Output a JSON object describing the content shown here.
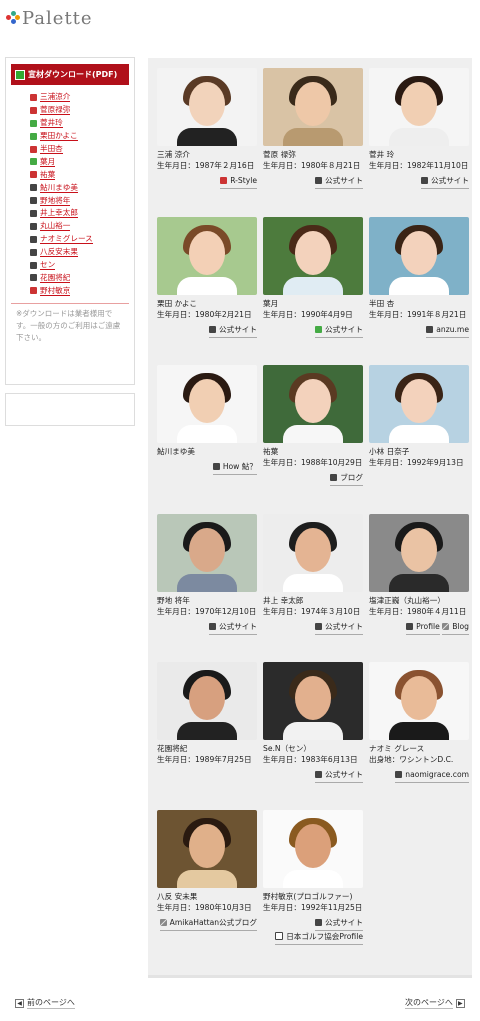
{
  "site": {
    "logo": "Palette"
  },
  "sidebar": {
    "heading": "宣材ダウンロード(PDF)",
    "items": [
      {
        "label": "三浦涼介",
        "color": "#c33"
      },
      {
        "label": "菅原禄弥",
        "color": "#c33"
      },
      {
        "label": "菅井玲",
        "color": "#4a4"
      },
      {
        "label": "栗田かよこ",
        "color": "#4a4"
      },
      {
        "label": "半田杏",
        "color": "#c33"
      },
      {
        "label": "葉月",
        "color": "#4a4"
      },
      {
        "label": "祐葉",
        "color": "#c33"
      },
      {
        "label": "鮎川まゆ美",
        "color": "#444"
      },
      {
        "label": "野地将年",
        "color": "#444"
      },
      {
        "label": "井上幸太郎",
        "color": "#444"
      },
      {
        "label": "丸山裕一",
        "color": "#444"
      },
      {
        "label": "ナオミグレース",
        "color": "#444"
      },
      {
        "label": "八反安末果",
        "color": "#444"
      },
      {
        "label": "セン",
        "color": "#444"
      },
      {
        "label": "花園将紀",
        "color": "#444"
      },
      {
        "label": "野村敏京",
        "color": "#c33"
      }
    ],
    "note": "※ダウンロードは業者様用です。一般の方のご利用はご遠慮下さい。"
  },
  "talents": [
    {
      "name": "三浦 涼介",
      "birth": "生年月日：1987年２月16日",
      "links": [
        {
          "label": "R-Style",
          "icon": "red"
        }
      ],
      "photo": {
        "bg": "#f3f3f3",
        "hair": "#5a3a25",
        "skin": "#f2d3bb",
        "clothes": "#222"
      }
    },
    {
      "name": "菅原 禄弥",
      "birth": "生年月日：1980年８月21日",
      "links": [
        {
          "label": "公式サイト",
          "icon": "dark"
        }
      ],
      "photo": {
        "bg": "#d9c3a5",
        "hair": "#3a2a1a",
        "skin": "#eec8a8",
        "clothes": "#b89a70"
      }
    },
    {
      "name": "菅井 玲",
      "birth": "生年月日：1982年11月10日",
      "links": [
        {
          "label": "公式サイト",
          "icon": "dark"
        }
      ],
      "photo": {
        "bg": "#f5f5f5",
        "hair": "#2a1a12",
        "skin": "#f1cfb3",
        "clothes": "#eee"
      }
    },
    {
      "name": "栗田 かよこ",
      "birth": "生年月日：1980年2月21日",
      "links": [
        {
          "label": "公式サイト",
          "icon": "dark"
        }
      ],
      "photo": {
        "bg": "#a7c98f",
        "hair": "#7a4a28",
        "skin": "#f3d0b6",
        "clothes": "#fff"
      }
    },
    {
      "name": "葉月",
      "birth": "生年月日：1990年4月9日",
      "links": [
        {
          "label": "公式サイト",
          "icon": "grn"
        }
      ],
      "photo": {
        "bg": "#4d7b3d",
        "hair": "#4a2a18",
        "skin": "#f3d2bc",
        "clothes": "#e0ecf3"
      }
    },
    {
      "name": "半田 杏",
      "birth": "生年月日：1991年８月21日",
      "links": [
        {
          "label": "anzu.me",
          "icon": "dark"
        }
      ],
      "photo": {
        "bg": "#7fb1c8",
        "hair": "#3a2416",
        "skin": "#f3d2bc",
        "clothes": "#fff"
      }
    },
    {
      "name": "鮎川まゆ美",
      "birth": "",
      "links": [
        {
          "label": "How 鮎？",
          "icon": "dark"
        }
      ],
      "photo": {
        "bg": "#f6f6f6",
        "hair": "#2a1a12",
        "skin": "#f1cfb3",
        "clothes": "#fff"
      }
    },
    {
      "name": "祐葉",
      "birth": "生年月日：1988年10月29日",
      "links": [
        {
          "label": "ブログ",
          "icon": "dark"
        }
      ],
      "photo": {
        "bg": "#3f6a3a",
        "hair": "#5a3a22",
        "skin": "#f3d2bc",
        "clothes": "#f7f7f7"
      }
    },
    {
      "name": "小林 日奈子",
      "birth": "生年月日：1992年9月13日",
      "links": [],
      "photo": {
        "bg": "#b7d2e2",
        "hair": "#3a2416",
        "skin": "#f3d2bc",
        "clothes": "#fff"
      }
    },
    {
      "name": "野地 将年",
      "birth": "生年月日：1970年12月10日",
      "links": [
        {
          "label": "公式サイト",
          "icon": "dark"
        }
      ],
      "photo": {
        "bg": "#b9c7b8",
        "hair": "#1a1a1a",
        "skin": "#d9a98a",
        "clothes": "#7c8aa0"
      }
    },
    {
      "name": "井上 幸太郎",
      "birth": "生年月日：1974年３月10日",
      "links": [
        {
          "label": "公式サイト",
          "icon": "dark"
        }
      ],
      "photo": {
        "bg": "#ededed",
        "hair": "#1e1e1e",
        "skin": "#e4b493",
        "clothes": "#fff"
      }
    },
    {
      "name": "塩津正巍（丸山裕一）",
      "birth": "生年月日：1980年４月11日",
      "links": [
        {
          "label": "Profile",
          "icon": "dark"
        },
        {
          "label": "Blog",
          "icon": "pen"
        }
      ],
      "photo": {
        "bg": "#8a8a8a",
        "hair": "#1a1a1a",
        "skin": "#eac3a4",
        "clothes": "#2a2a2a"
      }
    },
    {
      "name": "花園将紀",
      "birth": "生年月日：1989年7月25日",
      "links": [],
      "photo": {
        "bg": "#eaeaea",
        "hair": "#1a1a1a",
        "skin": "#d7a07f",
        "clothes": "#222"
      }
    },
    {
      "name": "Se.N（セン）",
      "birth": "生年月日：1983年6月13日",
      "links": [
        {
          "label": "公式サイト",
          "icon": "dark"
        }
      ],
      "photo": {
        "bg": "#2b2b2b",
        "hair": "#3a2a1a",
        "skin": "#e2b08e",
        "clothes": "#f2f2f2"
      }
    },
    {
      "name": "ナオミ グレース",
      "birth": "出身地：ワシントンD.C.",
      "links": [
        {
          "label": "naomigrace.com",
          "icon": "dark"
        }
      ],
      "photo": {
        "bg": "#f7f7f7",
        "hair": "#8a5230",
        "skin": "#e9bb98",
        "clothes": "#1a1a1a"
      }
    },
    {
      "name": "八反 安未果",
      "birth": "生年月日：1980年10月3日",
      "links": [
        {
          "label": "AmikaHattan公式ブログ",
          "icon": "pen"
        }
      ],
      "photo": {
        "bg": "#6d5432",
        "hair": "#2a1a10",
        "skin": "#e0b08a",
        "clothes": "#e4c9a0"
      }
    },
    {
      "name": "野村敏京(プロゴルファー)",
      "birth": "生年月日：1992年11月25日",
      "links": [
        {
          "label": "公式サイト",
          "icon": "dark"
        },
        {
          "label": "日本ゴルフ協会Profile",
          "icon": "play"
        }
      ],
      "photo": {
        "bg": "#fafafa",
        "hair": "#8a5a20",
        "skin": "#dba07a",
        "clothes": "#fff"
      }
    }
  ],
  "pager": {
    "prev": "前のページへ",
    "next": "次のページへ"
  }
}
